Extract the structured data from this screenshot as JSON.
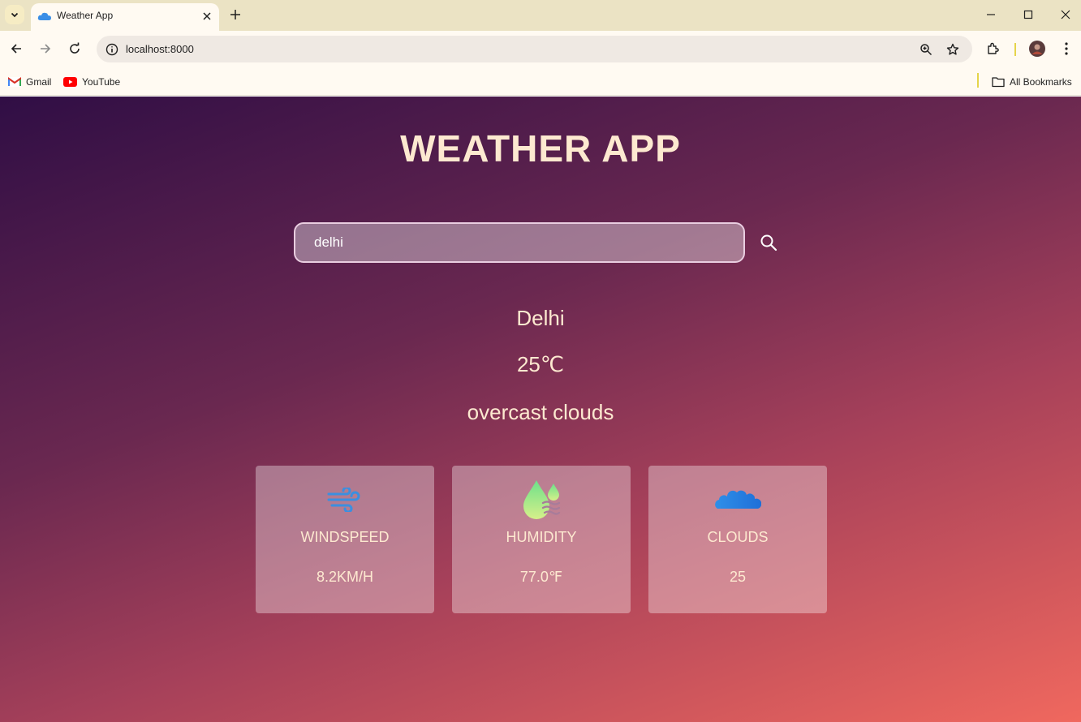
{
  "browser": {
    "tab_title": "Weather App",
    "url": "localhost:8000",
    "bookmarks": [
      {
        "label": "Gmail",
        "icon": "gmail-icon"
      },
      {
        "label": "YouTube",
        "icon": "youtube-icon"
      }
    ],
    "all_bookmarks_label": "All Bookmarks"
  },
  "app": {
    "title": "WEATHER APP",
    "search": {
      "value": "delhi",
      "icon": "search-icon"
    },
    "city": "Delhi",
    "temperature": "25℃",
    "description": "overcast clouds",
    "cards": [
      {
        "icon": "wind-icon",
        "label": "WINDSPEED",
        "value": "8.2KM/H"
      },
      {
        "icon": "humidity-drop-icon",
        "label": "HUMIDITY",
        "value": "77.0℉"
      },
      {
        "icon": "clouds-icon",
        "label": "CLOUDS",
        "value": "25"
      }
    ]
  },
  "colors": {
    "text_accent": "#fde9d0",
    "gradient_start": "#300e45",
    "gradient_end": "#f0685e"
  }
}
